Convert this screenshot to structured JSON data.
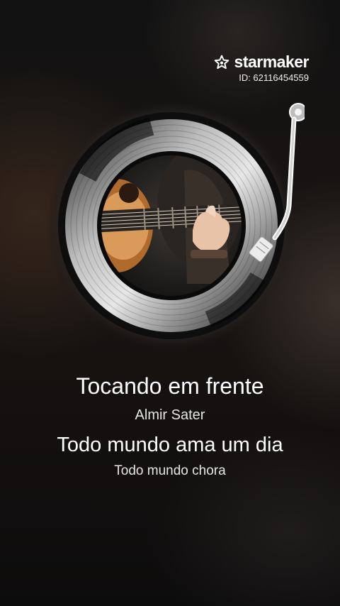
{
  "brand": {
    "name": "starmaker",
    "user_id": "ID: 62116454559",
    "logo_icon": "star-logo-icon"
  },
  "song": {
    "title": "Tocando em frente",
    "artist": "Almir Sater"
  },
  "lyrics": {
    "current": "Todo mundo ama um dia",
    "next": "Todo mundo chora"
  },
  "record": {
    "cover_icon": "guitar-player-cover-image",
    "tonearm_icon": "tonearm-icon"
  },
  "colors": {
    "background": "#0b0b0c",
    "text": "#ffffff",
    "vinyl_groove": "#cfcfcf"
  }
}
